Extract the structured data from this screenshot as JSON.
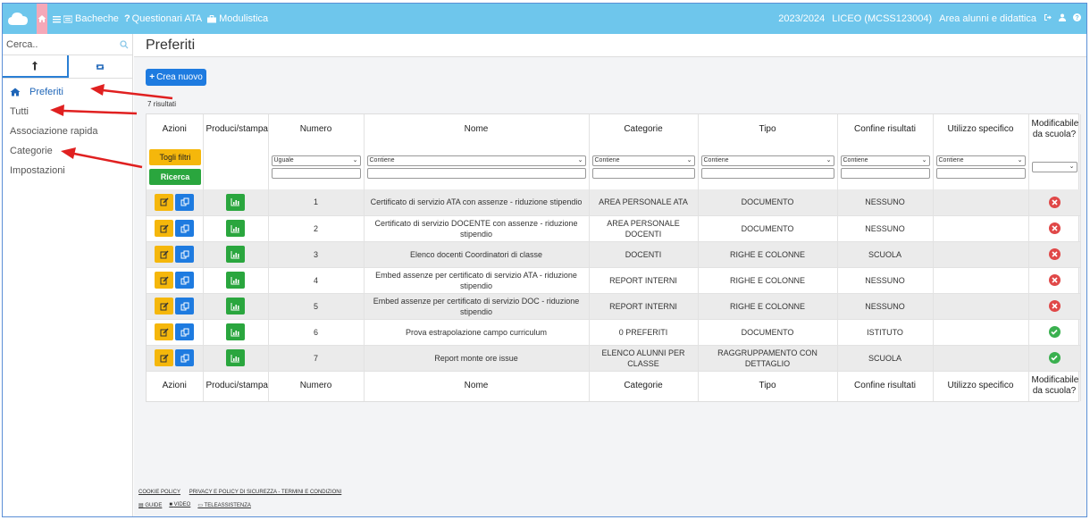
{
  "topbar": {
    "nav": [
      {
        "label": "Bacheche",
        "icon": "list-icon"
      },
      {
        "label": "Questionari ATA",
        "icon": "question-icon"
      },
      {
        "label": "Modulistica",
        "icon": "briefcase-icon"
      }
    ],
    "year": "2023/2024",
    "school": "LICEO (MCSS123004)",
    "area": "Area alunni e didattica"
  },
  "sidebar": {
    "search_placeholder": "Cerca..",
    "items": [
      {
        "label": "Preferiti"
      },
      {
        "label": "Tutti"
      },
      {
        "label": "Associazione rapida"
      },
      {
        "label": "Categorie"
      },
      {
        "label": "Impostazioni"
      }
    ]
  },
  "main": {
    "title": "Preferiti",
    "new_button": "Crea nuovo",
    "results": "7 risultati",
    "columns": [
      "Azioni",
      "Produci/stampa",
      "Numero",
      "Nome",
      "Categorie",
      "Tipo",
      "Confine risultati",
      "Utilizzo specifico",
      "Modificabile da scuola?"
    ],
    "filters": {
      "toggle": "Togli filtri",
      "search": "Ricerca",
      "numero": "Uguale",
      "nome": "Contiene",
      "categorie": "Contiene",
      "tipo": "Contiene",
      "confine": "Contiene",
      "utilizzo": "Contiene",
      "modificabile": ""
    },
    "rows": [
      {
        "numero": "1",
        "nome": "Certificato di servizio ATA con assenze - riduzione stipendio",
        "categorie": "AREA PERSONALE ATA",
        "tipo": "DOCUMENTO",
        "confine": "NESSUNO",
        "utilizzo": "",
        "mod": false
      },
      {
        "numero": "2",
        "nome": "Certificato di servizio DOCENTE con assenze - riduzione stipendio",
        "categorie": "AREA PERSONALE DOCENTI",
        "tipo": "DOCUMENTO",
        "confine": "NESSUNO",
        "utilizzo": "",
        "mod": false
      },
      {
        "numero": "3",
        "nome": "Elenco docenti Coordinatori di classe",
        "categorie": "DOCENTI",
        "tipo": "RIGHE E COLONNE",
        "confine": "SCUOLA",
        "utilizzo": "",
        "mod": false
      },
      {
        "numero": "4",
        "nome": "Embed assenze per certificato di servizio ATA - riduzione stipendio",
        "categorie": "REPORT INTERNI",
        "tipo": "RIGHE E COLONNE",
        "confine": "NESSUNO",
        "utilizzo": "",
        "mod": false
      },
      {
        "numero": "5",
        "nome": "Embed assenze per certificato di servizio DOC - riduzione stipendio",
        "categorie": "REPORT INTERNI",
        "tipo": "RIGHE E COLONNE",
        "confine": "NESSUNO",
        "utilizzo": "",
        "mod": false
      },
      {
        "numero": "6",
        "nome": "Prova estrapolazione campo curriculum",
        "categorie": "0 PREFERITI",
        "tipo": "DOCUMENTO",
        "confine": "ISTITUTO",
        "utilizzo": "",
        "mod": true
      },
      {
        "numero": "7",
        "nome": "Report monte ore issue",
        "categorie": "ELENCO ALUNNI PER CLASSE",
        "tipo": "RAGGRUPPAMENTO CON DETTAGLIO",
        "confine": "SCUOLA",
        "utilizzo": "",
        "mod": true
      }
    ]
  },
  "footer": {
    "links": [
      "COOKIE POLICY",
      "PRIVACY E POLICY DI SICUREZZA - TERMINI E CONDIZIONI"
    ],
    "help": [
      "GUIDE",
      "VIDEO",
      "TELEASSISTENZA"
    ]
  },
  "colors": {
    "topbar": "#6ec6ec",
    "primary": "#1e7be0",
    "warning": "#f5b70b",
    "success": "#2aa63e",
    "danger": "#e04848",
    "arrow": "#e02020"
  }
}
